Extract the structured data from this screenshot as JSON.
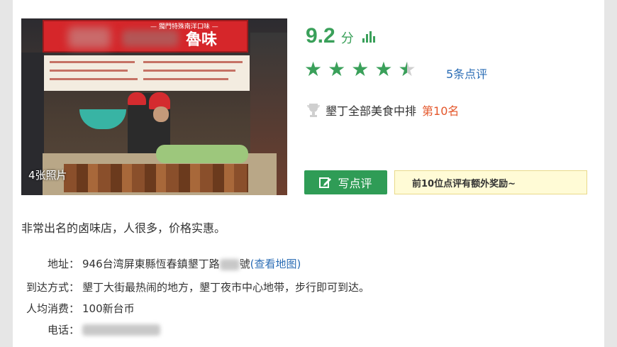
{
  "photo": {
    "sign_top": "— 獨門特殊南洋口味 —",
    "sign_text": "魯味",
    "count_label": "4张照片"
  },
  "rating": {
    "score": "9.2",
    "unit": "分",
    "stars_value": 4.5,
    "stars_max": 5,
    "reviews_link": "5条点评",
    "rank_prefix": "墾丁全部美食中排",
    "rank_value": "第10名",
    "icon_bars": "bar-chart-icon",
    "icon_trophy": "trophy-icon"
  },
  "actions": {
    "write_review": "写点评",
    "write_icon": "edit-icon",
    "reward_text": "前10位点评有额外奖励~"
  },
  "description": "非常出名的卤味店，人很多，价格实惠。",
  "info": {
    "address_label": "地址：",
    "address_value": "946台湾屏東縣恆春鎮墾丁路",
    "address_suffix": "號",
    "map_link": "(查看地图)",
    "transport_label": "到达方式：",
    "transport_value": "墾丁大街最热闹的地方，墾丁夜市中心地带，步行即可到达。",
    "cost_label": "人均消费：",
    "cost_value": "100新台币",
    "phone_label": "电话："
  },
  "colors": {
    "accent_green": "#3aa05a",
    "link_blue": "#2b6db5",
    "rank_orange": "#e4572b"
  }
}
